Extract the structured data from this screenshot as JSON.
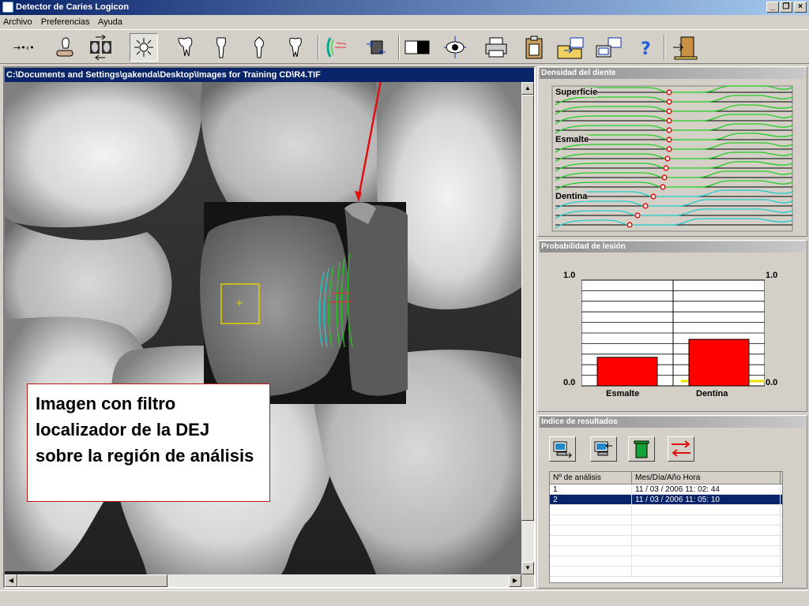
{
  "window": {
    "title": "Detector de Caries Logicon"
  },
  "menu": {
    "items": [
      "Archivo",
      "Preferencias",
      "Ayuda"
    ]
  },
  "toolbar": {
    "tools": [
      "arrows-left-icon",
      "hand-tooth-icon",
      "compare-images-icon",
      "light-filter-icon",
      "molar-icon",
      "incisor-icon",
      "canine-icon",
      "premolar-icon",
      "dej-filter-icon",
      "flip-icon",
      "contrast-icon",
      "target-eye-icon",
      "printer-icon",
      "clipboard-icon",
      "export-folder-icon",
      "export-image-icon",
      "help-icon",
      "exit-icon"
    ]
  },
  "image": {
    "path": "C:\\Documents and Settings\\gakenda\\Desktop\\Images for Training CD\\R4.TIF"
  },
  "callout": {
    "text": "Imagen con filtro localizador de la DEJ sobre la región de análisis"
  },
  "density": {
    "title": "Densidad del diente",
    "labels": {
      "surface": "Superficie",
      "enamel": "Esmalte",
      "dentin": "Dentina"
    },
    "colors": {
      "enamel": "#22cc22",
      "dentin": "#22cccc",
      "marker": "#e01010"
    }
  },
  "probability": {
    "title": "Probabilidad de lesión",
    "ymax_left": "1.0",
    "ymax_right": "1.0",
    "ymin_left": "0.0",
    "ymin_right": "0.0",
    "bars": [
      {
        "label": "Esmalte",
        "value": 0.27
      },
      {
        "label": "Dentina",
        "value": 0.44
      }
    ],
    "threshold_color": "#e8e000",
    "bar_color": "#ff0000"
  },
  "results": {
    "title": "Indice de resultados",
    "columns": [
      "Nº de análisis",
      "Mes/Día/Año  Hora"
    ],
    "rows": [
      {
        "n": "1",
        "date": "11 / 03 / 2006   11: 02: 44",
        "selected": false
      },
      {
        "n": "2",
        "date": "11 / 03 / 2006   11: 05: 10",
        "selected": true
      }
    ]
  }
}
